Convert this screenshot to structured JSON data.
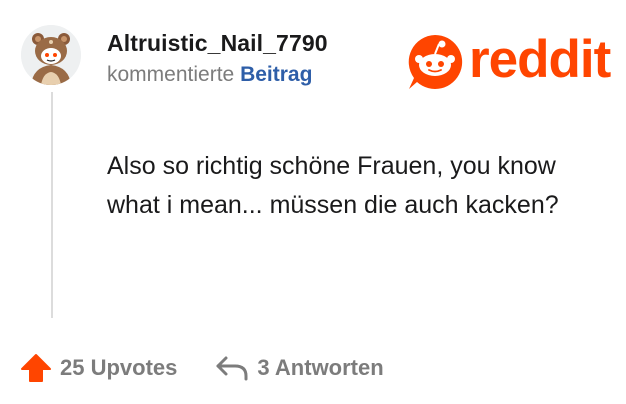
{
  "comment": {
    "username": "Altruistic_Nail_7790",
    "action": "kommentierte",
    "target_link": "Beitrag",
    "body": "Also so richtig schöne Frauen, you know what i mean... müssen die auch kacken?"
  },
  "brand": {
    "wordmark": "reddit",
    "color": "#ff4500"
  },
  "footer": {
    "upvotes_label": "25 Upvotes",
    "replies_label": "3 Antworten"
  },
  "icons": {
    "avatar": "avatar-bear-icon",
    "logo": "reddit-snoo-icon",
    "upvote": "upvote-arrow-icon",
    "reply": "reply-arrow-icon"
  },
  "colors": {
    "username": "#1a1a1b",
    "meta": "#7c7c7c",
    "link": "#2e5ea8",
    "upvote": "#ff4500",
    "thread_line": "#dcdcdc"
  }
}
